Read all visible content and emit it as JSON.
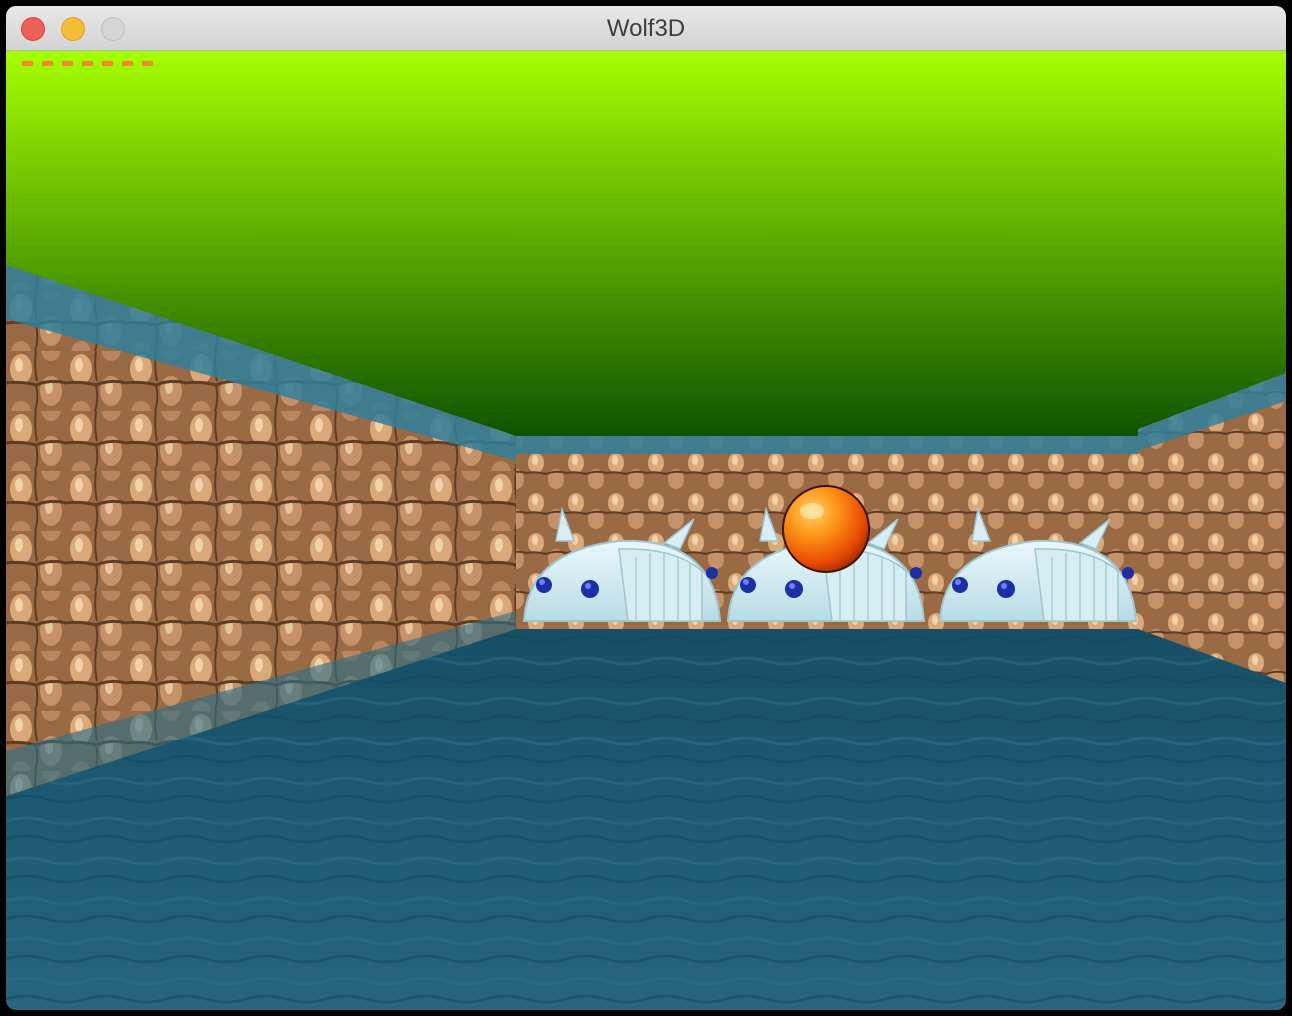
{
  "window": {
    "title": "Wolf3D"
  },
  "hud": {
    "dash_count": 7,
    "dash_color": "#f4863a"
  },
  "scene": {
    "ceiling_colors": [
      "#a6ff00",
      "#004400"
    ],
    "floor_color": "#1f5a72",
    "wall_texture": "brown-rock",
    "wall_top_trim_color": "#2f7f9a",
    "objects": [
      {
        "name": "dome-pod-left",
        "type": "dome-creature"
      },
      {
        "name": "dome-pod-center",
        "type": "dome-creature"
      },
      {
        "name": "dome-pod-right",
        "type": "dome-creature"
      },
      {
        "name": "orange-ball",
        "type": "orb"
      }
    ]
  }
}
